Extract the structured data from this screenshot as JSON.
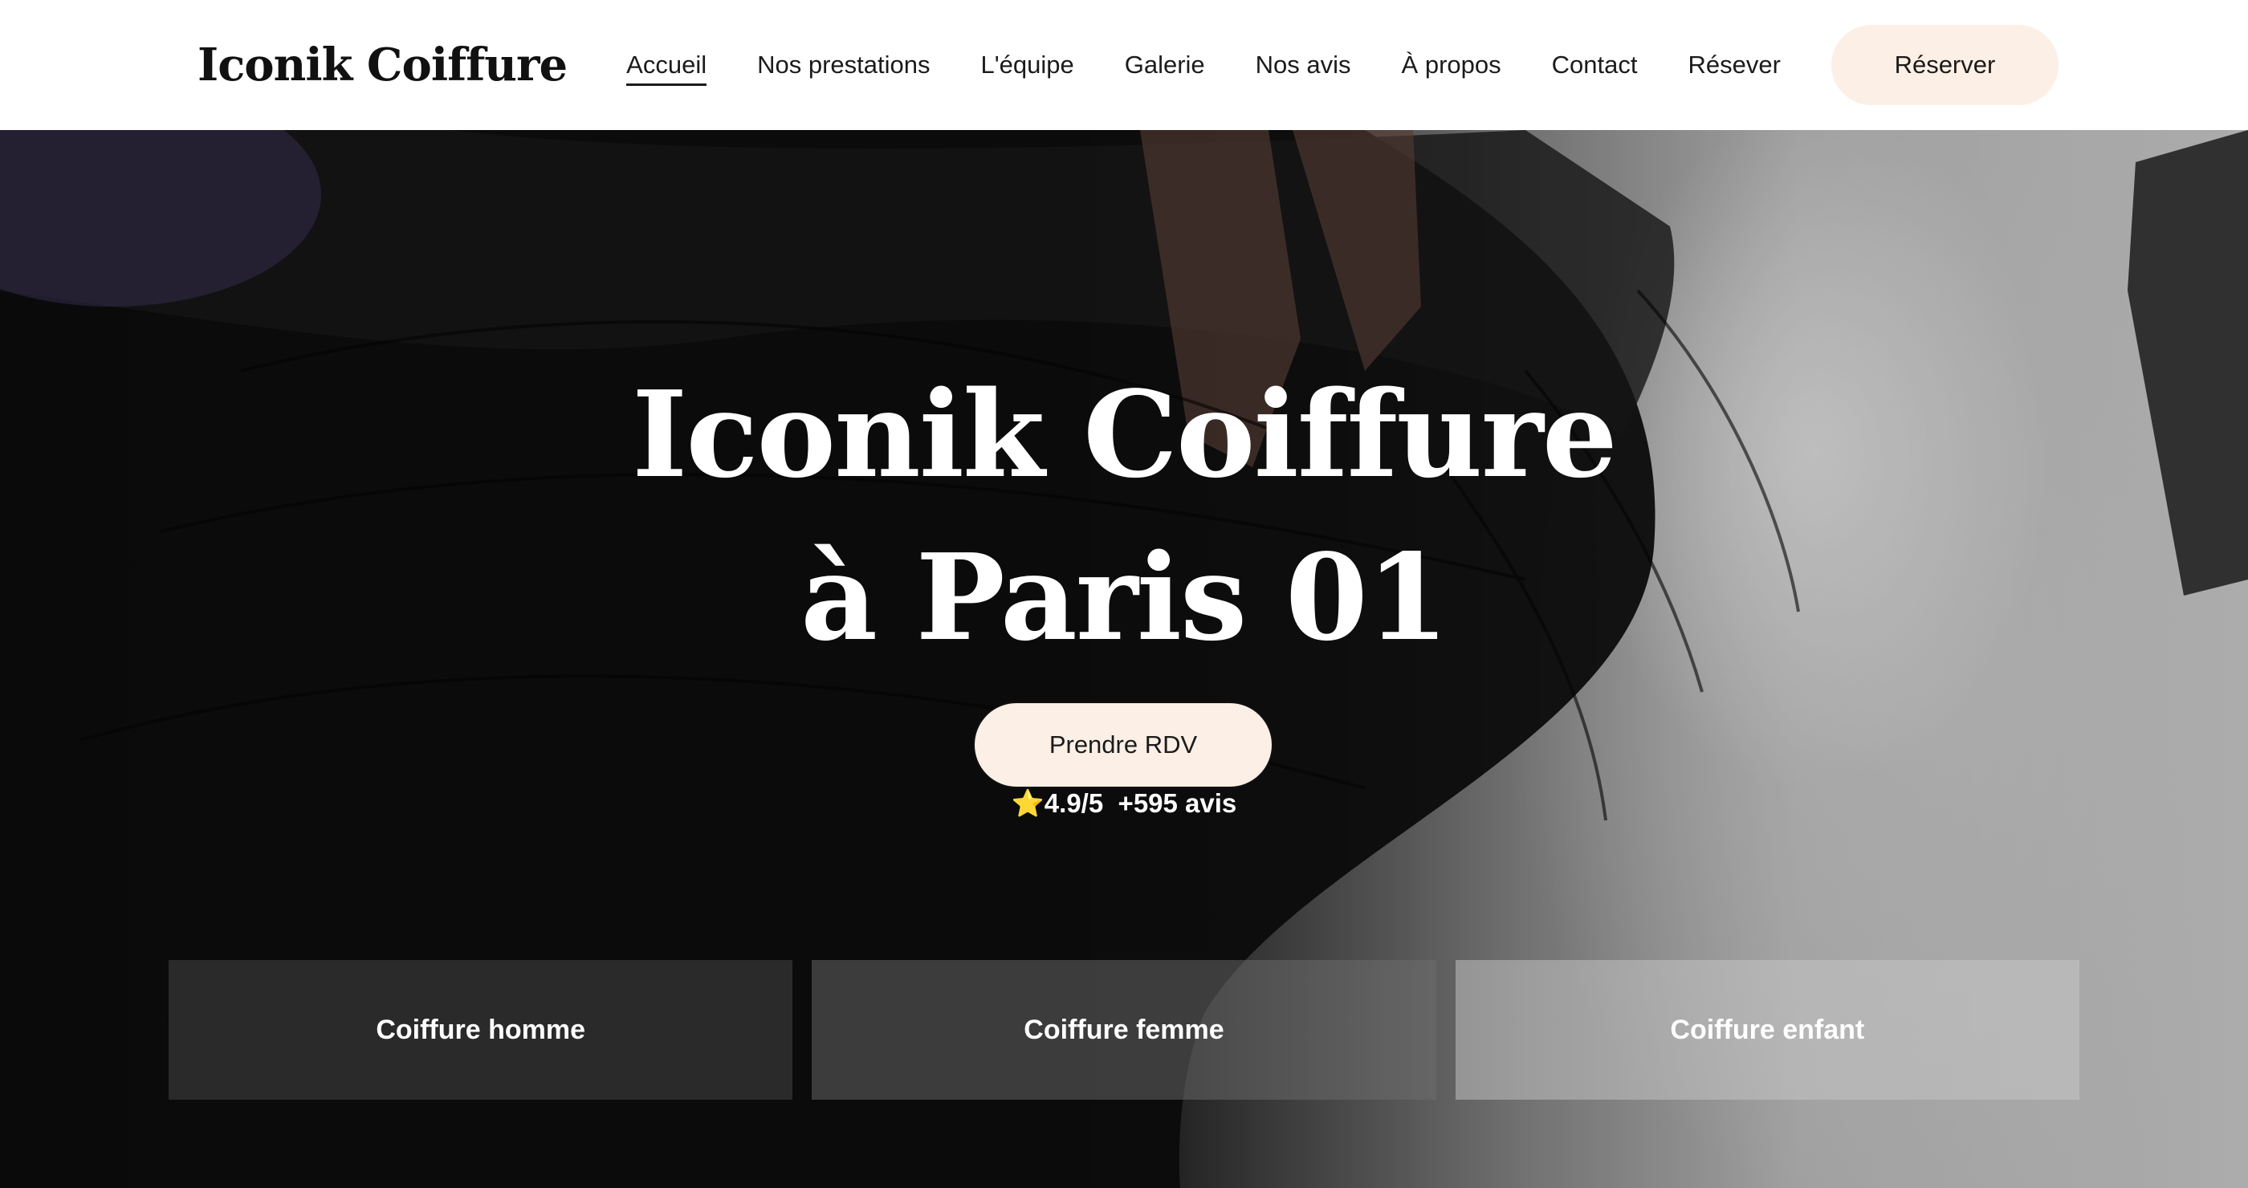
{
  "header": {
    "logo": "Iconik Coiffure",
    "nav": [
      {
        "label": "Accueil",
        "active": true
      },
      {
        "label": "Nos prestations"
      },
      {
        "label": "L'équipe"
      },
      {
        "label": "Galerie"
      },
      {
        "label": "Nos avis"
      },
      {
        "label": "À propos"
      },
      {
        "label": "Contact"
      },
      {
        "label": "Résever"
      }
    ],
    "cta_label": "Réserver"
  },
  "hero": {
    "title_line1": "Iconik Coiffure",
    "title_line2": "à Paris 01",
    "cta_label": "Prendre RDV",
    "rating_icon": "⭐",
    "rating": "4.9/5",
    "reviews": "+595 avis"
  },
  "cards": [
    {
      "label": "Coiffure homme"
    },
    {
      "label": "Coiffure femme"
    },
    {
      "label": "Coiffure enfant"
    }
  ],
  "colors": {
    "accent_bg": "#fcefe5",
    "header_bg": "#ffffff",
    "text_dark": "#1b1b1b",
    "star": "#f5c518"
  }
}
